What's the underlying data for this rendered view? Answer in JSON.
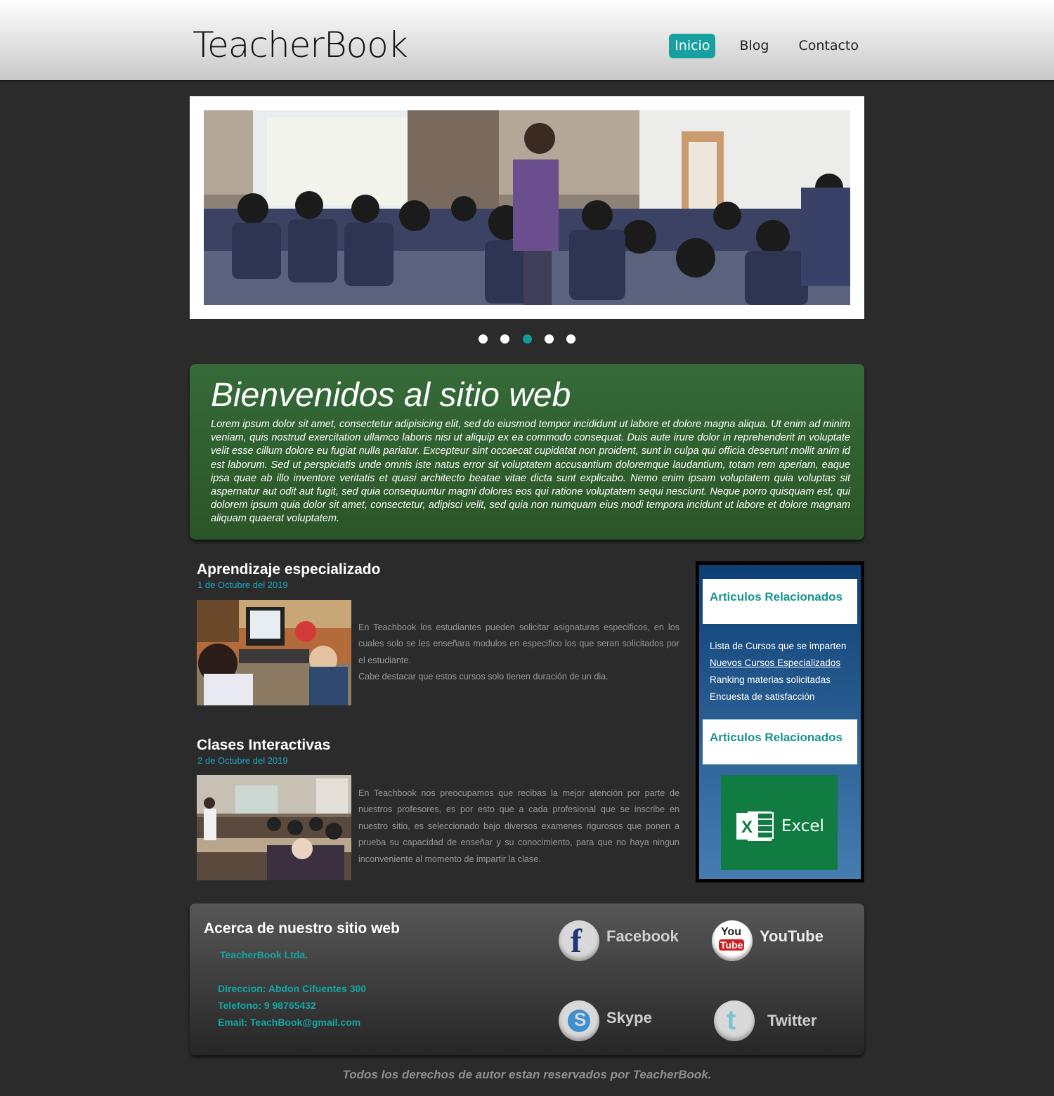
{
  "header": {
    "logo": "TeacherBook",
    "nav": [
      {
        "label": "Inicio",
        "active": true
      },
      {
        "label": "Blog",
        "active": false
      },
      {
        "label": "Contacto",
        "active": false
      }
    ]
  },
  "slider": {
    "dot_count": 5,
    "active_dot": 3
  },
  "welcome": {
    "title": "Bienvenidos al sitio web",
    "text": "Lorem ipsum dolor sit amet, consectetur adipisicing elit, sed do eiusmod tempor incididunt ut labore et dolore magna aliqua. Ut enim ad minim veniam, quis nostrud exercitation ullamco laboris nisi ut aliquip ex ea commodo consequat. Duis aute irure dolor in reprehenderit in voluptate velit esse cillum dolore eu fugiat nulla pariatur. Excepteur sint occaecat cupidatat non proident, sunt in culpa qui officia deserunt mollit anim id est laborum. Sed ut perspiciatis unde omnis iste natus error sit voluptatem accusantium doloremque laudantium, totam rem aperiam, eaque ipsa quae ab illo inventore veritatis et quasi architecto beatae vitae dicta sunt explicabo. Nemo enim ipsam voluptatem quia voluptas sit aspernatur aut odit aut fugit, sed quia consequuntur magni dolores eos qui ratione voluptatem sequi nesciunt. Neque porro quisquam est, qui dolorem ipsum quia dolor sit amet, consectetur, adipisci velit, sed quia non numquam eius modi tempora incidunt ut labore et dolore magnam aliquam quaerat voluptatem."
  },
  "articles": [
    {
      "title": "Aprendizaje especializado",
      "date": "1 de Octubre del 2019",
      "paragraphs": [
        "En Teachbook los estudiantes pueden solicitar asignaturas especificos, en los cuales solo se les enseñara modulos en especifico los que seran solicitados por el estudiante.",
        "Cabe destacar que estos cursos solo tienen duración de un dia."
      ]
    },
    {
      "title": "Clases Interactivas",
      "date": "2 de Octubre del 2019",
      "paragraphs": [
        "En Teachbook nos preocupamos que recibas la mejor atención por parte de nuestros profesores, es por esto que a cada profesional que se inscribe en nuestro sitio, es seleccionado bajo diversos examenes rigurosos que ponen a prueba su capacidad de enseñar y su conocimiento, para que no haya ningun inconveniente al momento de impartir la clase."
      ]
    }
  ],
  "sidebar": {
    "heading1": "Articulos Relacionados",
    "links": [
      {
        "label": "Lista de Cursos que se imparten",
        "underline": false
      },
      {
        "label": "Nuevos Cursos Especializados",
        "underline": true
      },
      {
        "label": "Ranking materias solicitadas",
        "underline": false
      },
      {
        "label": "Encuesta de satisfacción",
        "underline": false
      }
    ],
    "heading2": "Articulos Relacionados",
    "excel_label": "Excel"
  },
  "footer": {
    "title": "Acerca de nuestro sitio web",
    "company": "TeacherBook Ltda.",
    "address": "Direccion: Abdon Cifuentes 300",
    "phone": "Telefono: 9 98765432",
    "email": "Email: TeachBook@gmail.com",
    "social": [
      {
        "label": "Facebook",
        "icon": "facebook-icon"
      },
      {
        "label": "YouTube",
        "icon": "youtube-icon",
        "icon_text_1": "You",
        "icon_text_2": "Tube"
      },
      {
        "label": "Skype",
        "icon": "skype-icon"
      },
      {
        "label": "Twitter",
        "icon": "twitter-icon"
      }
    ]
  },
  "copyright": "Todos los derechos de autor estan reservados por TeacherBook.",
  "colors": {
    "accent": "#16a0a0",
    "welcome_bg": "#30602f",
    "sidebar_top": "#0d3f74",
    "sidebar_bottom": "#467db1",
    "excel_green": "#107c41"
  }
}
